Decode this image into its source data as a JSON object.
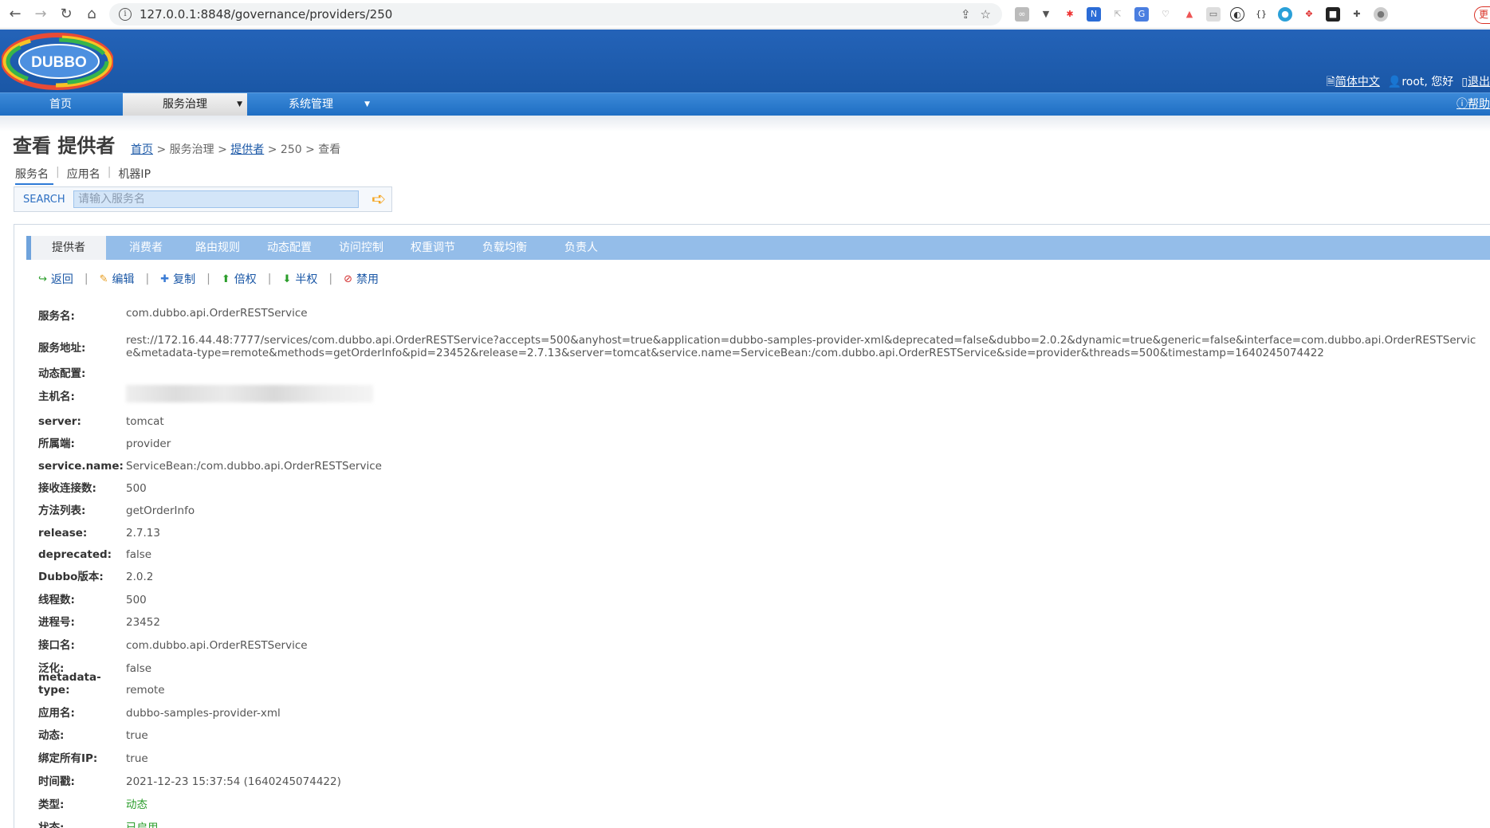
{
  "browser": {
    "url": "127.0.0.1:8848/governance/providers/250",
    "update_label": "更新"
  },
  "header": {
    "logo_text": "DUBBO",
    "language": "简体中文",
    "user_greeting": "root, 您好",
    "logout": "退出"
  },
  "menu": {
    "items": [
      {
        "label": "首页"
      },
      {
        "label": "服务治理"
      },
      {
        "label": "系统管理"
      }
    ],
    "help": "帮助"
  },
  "page": {
    "title": "查看 提供者",
    "breadcrumb": [
      "首页",
      "服务治理",
      "提供者",
      "250",
      "查看"
    ]
  },
  "search": {
    "tabs": [
      "服务名",
      "应用名",
      "机器IP"
    ],
    "label": "SEARCH",
    "placeholder": "请输入服务名"
  },
  "sub_tabs": [
    "提供者",
    "消费者",
    "路由规则",
    "动态配置",
    "访问控制",
    "权重调节",
    "负载均衡",
    "负责人"
  ],
  "actions": [
    "返回",
    "编辑",
    "复制",
    "倍权",
    "半权",
    "禁用"
  ],
  "detail": [
    {
      "key": "服务名:",
      "value": "com.dubbo.api.OrderRESTService"
    },
    {
      "key": "服务地址:",
      "value": "rest://172.16.44.48:7777/services/com.dubbo.api.OrderRESTService?accepts=500&anyhost=true&application=dubbo-samples-provider-xml&deprecated=false&dubbo=2.0.2&dynamic=true&generic=false&interface=com.dubbo.api.OrderRESTService&metadata-type=remote&methods=getOrderInfo&pid=23452&release=2.7.13&server=tomcat&service.name=ServiceBean:/com.dubbo.api.OrderRESTService&side=provider&threads=500&timestamp=1640245074422"
    },
    {
      "key": "动态配置:",
      "value": ""
    },
    {
      "key": "主机名:",
      "value": ""
    },
    {
      "key": "server:",
      "value": "tomcat"
    },
    {
      "key": "所属端:",
      "value": "provider"
    },
    {
      "key": "service.name:",
      "value": "ServiceBean:/com.dubbo.api.OrderRESTService"
    },
    {
      "key": "接收连接数:",
      "value": "500"
    },
    {
      "key": "方法列表:",
      "value": "getOrderInfo"
    },
    {
      "key": "release:",
      "value": "2.7.13"
    },
    {
      "key": "deprecated:",
      "value": "false"
    },
    {
      "key": "Dubbo版本:",
      "value": "2.0.2"
    },
    {
      "key": "线程数:",
      "value": "500"
    },
    {
      "key": "进程号:",
      "value": "23452"
    },
    {
      "key": "接口名:",
      "value": "com.dubbo.api.OrderRESTService"
    },
    {
      "key": "泛化:",
      "value": "false"
    },
    {
      "key": "metadata-type:",
      "value": "remote"
    },
    {
      "key": "应用名:",
      "value": "dubbo-samples-provider-xml"
    },
    {
      "key": "动态:",
      "value": "true"
    },
    {
      "key": "绑定所有IP:",
      "value": "true"
    },
    {
      "key": "时间戳:",
      "value": "2021-12-23 15:37:54 (1640245074422)"
    },
    {
      "key": "类型:",
      "value": "动态"
    },
    {
      "key": "状态:",
      "value": "已启用"
    }
  ],
  "colors": {
    "header_blue": "#1a57a6",
    "menu_blue": "#2d7ad6",
    "subtab_blue": "#94bde9",
    "status_green": "#2a9d2a"
  }
}
